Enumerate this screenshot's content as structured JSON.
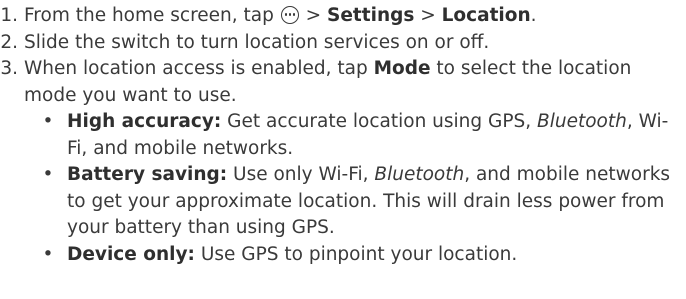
{
  "steps": [
    {
      "num": "1.",
      "pre": "From the home screen, tap",
      "icon": "apps-icon",
      "sep1": " > ",
      "b1": "Settings",
      "sep2": " > ",
      "b2": "Location",
      "post": "."
    },
    {
      "num": "2.",
      "text": "Slide the switch to turn location services on or off."
    },
    {
      "num": "3.",
      "pre": "When location access is enabled, tap ",
      "b1": "Mode",
      "post": " to select the location mode you want to use."
    }
  ],
  "bullets": [
    {
      "dot": "•",
      "label": "High accuracy:",
      "t1": " Get accurate location using GPS, ",
      "it": "Bluetooth",
      "t2": ", Wi-Fi, and mobile networks."
    },
    {
      "dot": "•",
      "label": "Battery saving:",
      "t1": " Use only Wi-Fi, ",
      "it": "Bluetooth",
      "t2": ", and mobile networks to get your approximate location. This will drain less power from your battery than using GPS."
    },
    {
      "dot": "•",
      "label": "Device only:",
      "t1": " Use GPS to pinpoint your location."
    }
  ]
}
